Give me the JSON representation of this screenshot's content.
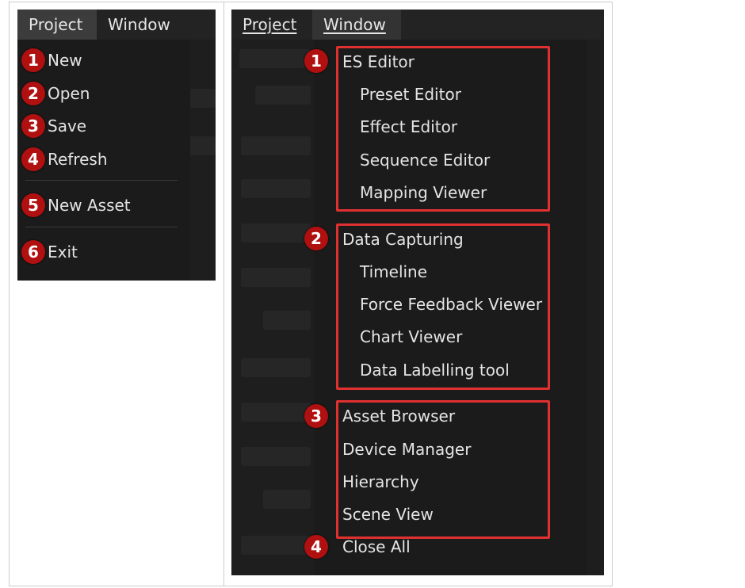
{
  "left_panel": {
    "menubar": {
      "project": "Project",
      "window": "Window"
    },
    "items": [
      {
        "badge": "1",
        "label": "New"
      },
      {
        "badge": "2",
        "label": "Open"
      },
      {
        "badge": "3",
        "label": "Save"
      },
      {
        "badge": "4",
        "label": "Refresh"
      },
      {
        "badge": "5",
        "label": "New Asset"
      },
      {
        "badge": "6",
        "label": "Exit"
      }
    ]
  },
  "right_panel": {
    "menubar": {
      "project": "Project",
      "window": "Window"
    },
    "groups": [
      {
        "badge": "1",
        "header": "ES Editor",
        "items": [
          "Preset Editor",
          "Effect Editor",
          "Sequence Editor",
          "Mapping Viewer"
        ]
      },
      {
        "badge": "2",
        "header": "Data Capturing",
        "items": [
          "Timeline",
          "Force Feedback Viewer",
          "Chart Viewer",
          "Data Labelling tool"
        ]
      },
      {
        "badge": "3",
        "header": "",
        "items": [
          "Asset Browser",
          "Device Manager",
          "Hierarchy",
          "Scene View"
        ]
      },
      {
        "badge": "4",
        "header": "Close All",
        "items": []
      }
    ]
  },
  "colors": {
    "badge": "#b01010",
    "highlight": "#e03030",
    "menu_bg": "#1b1b1b"
  }
}
